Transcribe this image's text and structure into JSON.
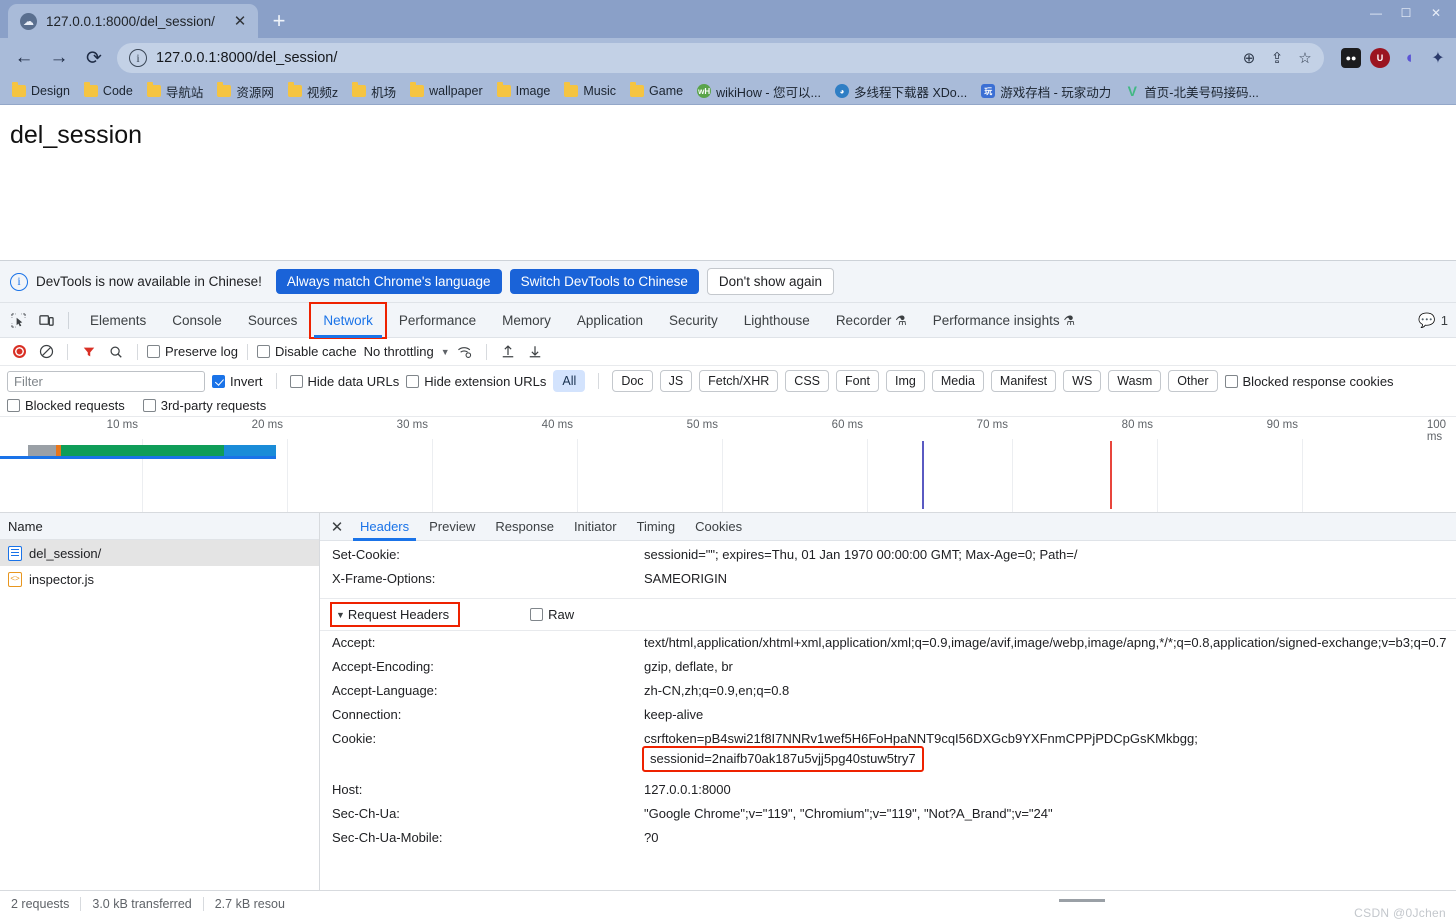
{
  "browser": {
    "tab": {
      "title": "127.0.0.1:8000/del_session/",
      "favicon": "globe-icon",
      "close": "✕"
    },
    "new_tab_label": "+",
    "window_controls": [
      "—",
      "☐",
      "✕"
    ],
    "nav": {
      "back": "←",
      "forward": "→",
      "reload": "⟳"
    },
    "omnibox": {
      "info_icon": "i",
      "url": "127.0.0.1:8000/del_session/",
      "zoom_icon": "⊕",
      "share_icon": "⇪",
      "star_icon": "☆"
    },
    "extensions": [
      {
        "name": "dark-square-extension",
        "glyph": "●●"
      },
      {
        "name": "ublock-origin-extension",
        "glyph": "U"
      },
      {
        "name": "purple-drop-extension",
        "glyph": "◖"
      },
      {
        "name": "puzzle-extensions-menu",
        "glyph": "✦"
      }
    ],
    "bookmarks": [
      {
        "label": "Design",
        "icon": "folder"
      },
      {
        "label": "Code",
        "icon": "folder"
      },
      {
        "label": "导航站",
        "icon": "folder"
      },
      {
        "label": "资源网",
        "icon": "folder"
      },
      {
        "label": "视频z",
        "icon": "folder"
      },
      {
        "label": "机场",
        "icon": "folder"
      },
      {
        "label": "wallpaper",
        "icon": "folder"
      },
      {
        "label": "Image",
        "icon": "folder"
      },
      {
        "label": "Music",
        "icon": "folder"
      },
      {
        "label": "Game",
        "icon": "folder"
      },
      {
        "label": "wikiHow - 您可以...",
        "icon": "site",
        "color": "#5aa44a",
        "glyph": "wH"
      },
      {
        "label": "多线程下载器 XDo...",
        "icon": "site",
        "color": "#2f7ec4",
        "glyph": "◕"
      },
      {
        "label": "游戏存档 - 玩家动力",
        "icon": "site",
        "color": "#3b6fd4",
        "glyph": "玩"
      },
      {
        "label": "首页-北美号码接码...",
        "icon": "site",
        "color": "#41b883",
        "glyph": "V"
      }
    ]
  },
  "page": {
    "heading": "del_session"
  },
  "devtools": {
    "banner": {
      "icon": "info-icon",
      "message": "DevTools is now available in Chinese!",
      "primary_button": "Always match Chrome's language",
      "secondary_button": "Switch DevTools to Chinese",
      "dismiss_button": "Don't show again"
    },
    "panel_tabs": [
      {
        "label": "Elements",
        "active": false,
        "flask": false
      },
      {
        "label": "Console",
        "active": false,
        "flask": false
      },
      {
        "label": "Sources",
        "active": false,
        "flask": false
      },
      {
        "label": "Network",
        "active": true,
        "flask": false,
        "highlighted": true
      },
      {
        "label": "Performance",
        "active": false,
        "flask": false
      },
      {
        "label": "Memory",
        "active": false,
        "flask": false
      },
      {
        "label": "Application",
        "active": false,
        "flask": false
      },
      {
        "label": "Security",
        "active": false,
        "flask": false
      },
      {
        "label": "Lighthouse",
        "active": false,
        "flask": false
      },
      {
        "label": "Recorder",
        "active": false,
        "flask": true
      },
      {
        "label": "Performance insights",
        "active": false,
        "flask": true
      }
    ],
    "message_count": "1",
    "toolbar": {
      "record_icon": "record-icon",
      "clear_icon": "clear-icon",
      "filter_icon": "filter-icon",
      "search_icon": "search-icon",
      "preserve_log": {
        "label": "Preserve log",
        "checked": false
      },
      "disable_cache": {
        "label": "Disable cache",
        "checked": false
      },
      "throttling": "No throttling",
      "wifi_icon": "network-conditions-icon",
      "import_icon": "import-har-icon",
      "export_icon": "export-har-icon"
    },
    "filters": {
      "filter_placeholder": "Filter",
      "filter_value": "",
      "invert": {
        "label": "Invert",
        "checked": true
      },
      "hide_data_urls": {
        "label": "Hide data URLs",
        "checked": false
      },
      "hide_extension_urls": {
        "label": "Hide extension URLs",
        "checked": false
      },
      "types": [
        "All",
        "Doc",
        "JS",
        "Fetch/XHR",
        "CSS",
        "Font",
        "Img",
        "Media",
        "Manifest",
        "WS",
        "Wasm",
        "Other"
      ],
      "active_type": "All",
      "blocked_response_cookies": {
        "label": "Blocked response cookies",
        "checked": false
      },
      "blocked_requests": {
        "label": "Blocked requests",
        "checked": false
      },
      "third_party_requests": {
        "label": "3rd-party requests",
        "checked": false
      }
    },
    "overview": {
      "ticks": [
        "10 ms",
        "20 ms",
        "30 ms",
        "40 ms",
        "50 ms",
        "60 ms",
        "70 ms",
        "80 ms",
        "90 ms",
        "100 ms"
      ],
      "dom_content_loaded_color": "#5a5ac2",
      "load_color": "#e8453c"
    },
    "requests": {
      "column_header": "Name",
      "rows": [
        {
          "name": "del_session/",
          "icon": "document-icon",
          "selected": true
        },
        {
          "name": "inspector.js",
          "icon": "script-icon",
          "selected": false
        }
      ]
    },
    "detail_tabs": [
      {
        "label": "Headers",
        "active": true
      },
      {
        "label": "Preview",
        "active": false
      },
      {
        "label": "Response",
        "active": false
      },
      {
        "label": "Initiator",
        "active": false
      },
      {
        "label": "Timing",
        "active": false
      },
      {
        "label": "Cookies",
        "active": false
      }
    ],
    "close_detail_icon": "✕",
    "response_headers_visible": [
      {
        "name": "Set-Cookie:",
        "value": "sessionid=\"\"; expires=Thu, 01 Jan 1970 00:00:00 GMT; Max-Age=0; Path=/"
      },
      {
        "name": "X-Frame-Options:",
        "value": "SAMEORIGIN"
      }
    ],
    "request_headers_section": {
      "title": "Request Headers",
      "triangle": "▼",
      "raw_label": "Raw",
      "raw_checked": false,
      "highlighted": true
    },
    "request_headers": [
      {
        "name": "Accept:",
        "value": "text/html,application/xhtml+xml,application/xml;q=0.9,image/avif,image/webp,image/apng,*/*;q=0.8,application/signed-exchange;v=b3;q=0.7"
      },
      {
        "name": "Accept-Encoding:",
        "value": "gzip, deflate, br"
      },
      {
        "name": "Accept-Language:",
        "value": "zh-CN,zh;q=0.9,en;q=0.8"
      },
      {
        "name": "Connection:",
        "value": "keep-alive"
      },
      {
        "name": "Cookie:",
        "value": "csrftoken=pB4swi21f8I7NNRv1wef5H6FoHpaNNT9cqI56DXGcb9YXFnmCPPjPDCpGsKMkbgg;",
        "value2": "sessionid=2naifb70ak187u5vjj5pg40stuw5try7",
        "value2_highlighted": true
      },
      {
        "name": "Host:",
        "value": "127.0.0.1:8000"
      },
      {
        "name": "Sec-Ch-Ua:",
        "value": "\"Google Chrome\";v=\"119\", \"Chromium\";v=\"119\", \"Not?A_Brand\";v=\"24\""
      },
      {
        "name": "Sec-Ch-Ua-Mobile:",
        "value": "?0"
      }
    ],
    "status_bar": {
      "requests": "2 requests",
      "transferred": "3.0 kB transferred",
      "resources": "2.7 kB resou"
    }
  },
  "watermark": "CSDN @0Jchen"
}
